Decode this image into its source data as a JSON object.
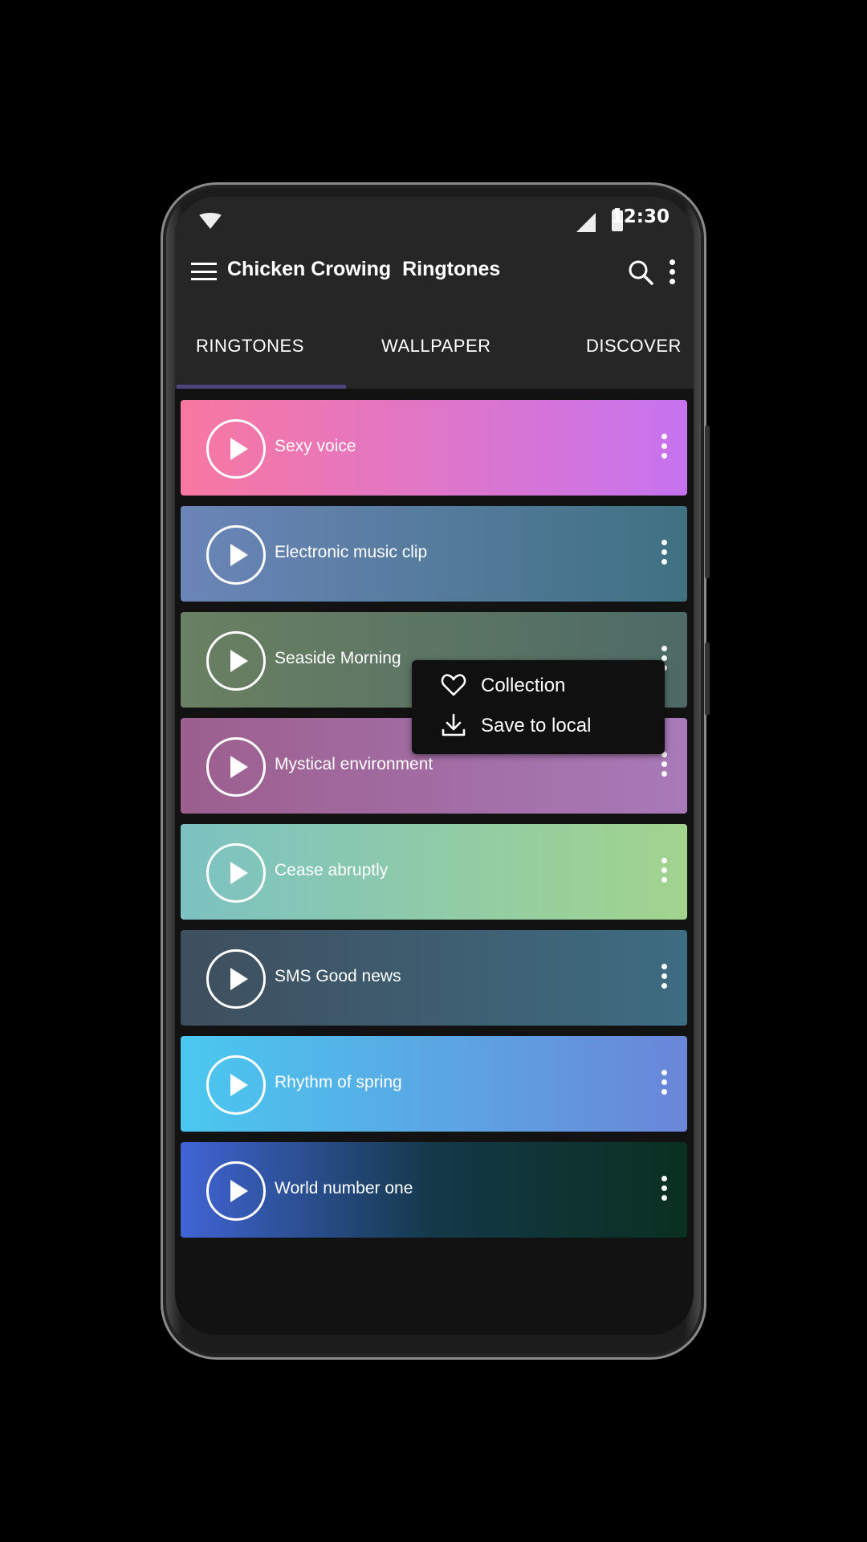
{
  "status_bar": {
    "time": "12:30",
    "icons": [
      "wifi-icon",
      "signal-icon",
      "battery-icon"
    ]
  },
  "toolbar": {
    "title": "Chicken Crowing  Ringtones",
    "icons": [
      "menu-icon",
      "search-icon",
      "more-vert-icon"
    ]
  },
  "tabs": [
    {
      "label": "RINGTONES",
      "active": true
    },
    {
      "label": "WALLPAPER"
    },
    {
      "label": "DISCOVER"
    }
  ],
  "accent": "#4e4580",
  "ringtones": [
    {
      "label": "Sexy voice",
      "colors": [
        "#f878a0",
        "#c673f0"
      ]
    },
    {
      "label": "Electronic music clip",
      "colors": [
        "#6b85b8",
        "#3f7182"
      ]
    },
    {
      "label": "Seaside Morning",
      "colors": [
        "#6a8062",
        "#4e6a66"
      ]
    },
    {
      "label": "Mystical environment",
      "colors": [
        "#9c5f8e",
        "#a87ab8"
      ]
    },
    {
      "label": "Cease abruptly",
      "colors": [
        "#7cc2c2",
        "#a2d48e"
      ]
    },
    {
      "label": "SMS Good news",
      "colors": [
        "#3e4f5e",
        "#3e6c82"
      ]
    },
    {
      "label": "Rhythm of spring",
      "colors": [
        "#4ac8f0",
        "#6a86d8"
      ]
    },
    {
      "label": "World number one",
      "colors": [
        "#4064d4",
        "#143848",
        "#0a3020"
      ]
    }
  ],
  "popup_menu": {
    "items": [
      {
        "label": "Collection",
        "icon": "heart-icon"
      },
      {
        "label": "Save to local",
        "icon": "download-icon"
      }
    ]
  }
}
